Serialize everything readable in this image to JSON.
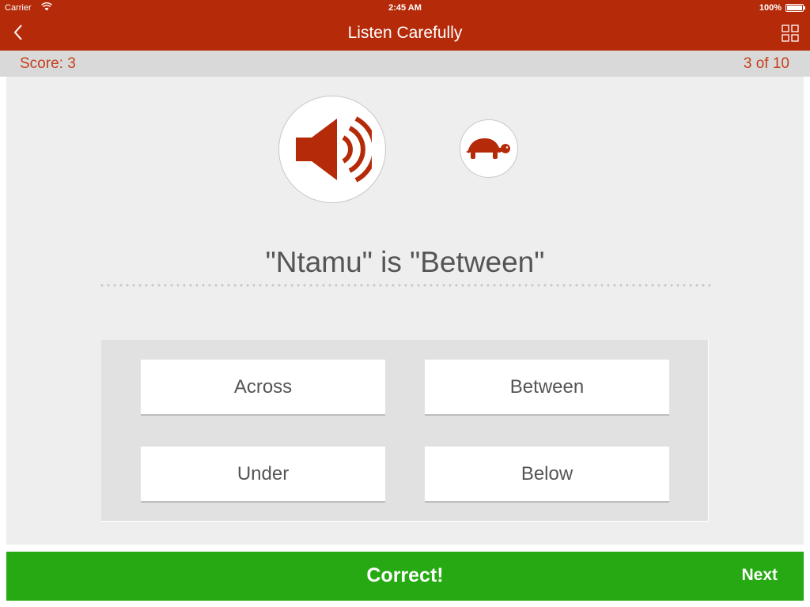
{
  "status": {
    "carrier": "Carrier",
    "time": "2:45 AM",
    "battery": "100%"
  },
  "nav": {
    "title": "Listen Carefully"
  },
  "score_bar": {
    "score": "Score: 3",
    "progress": "3 of 10"
  },
  "icons": {
    "back": "chevron-left-icon",
    "grid": "grid-icon",
    "speaker": "speaker-icon",
    "turtle": "turtle-icon",
    "wifi": "wifi-icon",
    "battery": "battery-icon"
  },
  "question": {
    "prompt": "\"Ntamu\" is \"Between\""
  },
  "answers": [
    {
      "label": "Across"
    },
    {
      "label": "Between"
    },
    {
      "label": "Under"
    },
    {
      "label": "Below"
    }
  ],
  "feedback": {
    "result": "Correct!",
    "next_label": "Next"
  },
  "colors": {
    "brand": "#b52b0a",
    "accent_text": "#c4401c",
    "success": "#27a913"
  }
}
